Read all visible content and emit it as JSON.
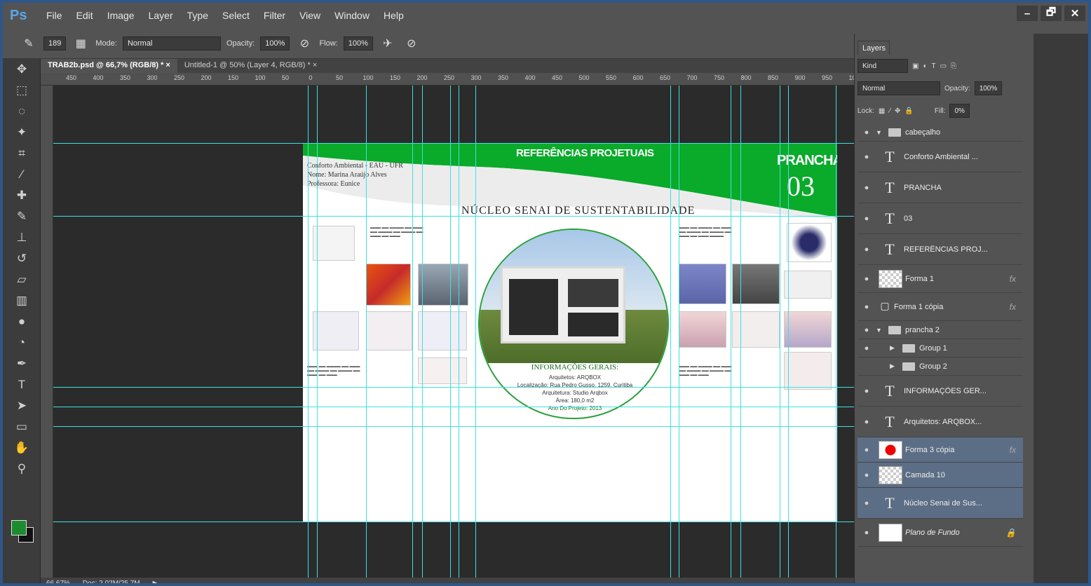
{
  "app": {
    "logo": "Ps",
    "menu": [
      "File",
      "Edit",
      "Image",
      "Layer",
      "Type",
      "Select",
      "Filter",
      "View",
      "Window",
      "Help"
    ],
    "window_controls": [
      "–",
      "🗗",
      "✕"
    ]
  },
  "options": {
    "brush_size": "189",
    "mode_label": "Mode:",
    "mode_value": "Normal",
    "opacity_label": "Opacity:",
    "opacity_value": "100%",
    "flow_label": "Flow:",
    "flow_value": "100%"
  },
  "tabs": [
    {
      "label": "TRAB2b.psd @ 66,7% (RGB/8) * ×",
      "active": true
    },
    {
      "label": "Untitled-1 @ 50% (Layer 4, RGB/8) * ×",
      "active": false
    }
  ],
  "ruler": [
    "450",
    "400",
    "350",
    "300",
    "250",
    "200",
    "150",
    "100",
    "50",
    "0",
    "50",
    "100",
    "150",
    "200",
    "250",
    "300",
    "350",
    "400",
    "450",
    "500",
    "550",
    "600",
    "650",
    "700",
    "750",
    "800",
    "850",
    "900",
    "950",
    "100"
  ],
  "document": {
    "banner_title": "REFERÊNCIAS PROJETUAIS",
    "prancha_label": "PRANCHA",
    "prancha_number": "03",
    "header_lines": [
      "Conforto Ambiental - EAU - UFR",
      "Nome: Marina Araújo Alves",
      "Professora: Eunice"
    ],
    "main_title": "NÚCLEO SENAI DE SUSTENTABILIDADE",
    "info_title": "INFORMAÇÕES GERAIS:",
    "info_lines": [
      "Arquitetos: ARQBOX",
      "Localização: Rua Pedro Gusso, 1259, Curitiba",
      "Arquitetura: Studio Arqbox",
      "Área: 180,0 m2",
      "Ano Do Projeto: 2013"
    ]
  },
  "layers_panel": {
    "tab": "Layers",
    "filter_kind": "Kind",
    "blend": "Normal",
    "opacity_label": "Opacity:",
    "opacity_value": "100%",
    "lock_label": "Lock:",
    "fill_label": "Fill:",
    "fill_value": "0%",
    "layers": [
      {
        "name": "cabeçalho",
        "kind": "group",
        "expanded": true
      },
      {
        "name": "Conforto Ambiental ...",
        "kind": "text"
      },
      {
        "name": "PRANCHA",
        "kind": "text"
      },
      {
        "name": "03",
        "kind": "text"
      },
      {
        "name": "REFERÊNCIAS PROJ...",
        "kind": "text"
      },
      {
        "name": "Forma 1",
        "kind": "shape",
        "fx": true
      },
      {
        "name": "Forma 1 cópia",
        "kind": "shape",
        "fx": true
      },
      {
        "name": "prancha 2",
        "kind": "group",
        "expanded": true
      },
      {
        "name": "Group 1",
        "kind": "subgroup"
      },
      {
        "name": "Group 2",
        "kind": "subgroup"
      },
      {
        "name": "INFORMAÇÕES GER...",
        "kind": "text"
      },
      {
        "name": "Arquitetos: ARQBOX...",
        "kind": "text"
      },
      {
        "name": "Forma 3 cópia",
        "kind": "shape",
        "fx": true,
        "selected": true
      },
      {
        "name": "Camada 10",
        "kind": "image",
        "selected": true
      },
      {
        "name": "Núcleo Senai de Sus...",
        "kind": "text",
        "selected": true
      },
      {
        "name": "Plano de Fundo",
        "kind": "background"
      }
    ]
  },
  "status": {
    "zoom": "66,67%",
    "doc": "Doc: 2,02M/25,7M"
  },
  "colors": {
    "banner": "#0aaa2a",
    "guide": "#40e0e0",
    "selected_layer": "#5c6e86"
  }
}
